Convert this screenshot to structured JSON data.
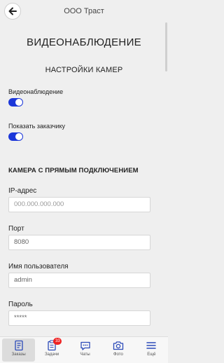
{
  "header": {
    "title": "ООО Траст"
  },
  "page": {
    "title": "ВИДЕОНАБЛЮДЕНИЕ",
    "section_title": "НАСТРОЙКИ КАМЕР"
  },
  "toggles": [
    {
      "label": "Видеонаблюдение",
      "on": true
    },
    {
      "label": "Показать заказчику",
      "on": true
    }
  ],
  "camera": {
    "heading": "КАМЕРА С ПРЯМЫМ ПОДКЛЮЧЕНИЕМ",
    "fields": [
      {
        "label": "IP-адрес",
        "value": "",
        "placeholder": "000.000.000.000"
      },
      {
        "label": "Порт",
        "value": "8080",
        "placeholder": ""
      },
      {
        "label": "Имя пользователя",
        "value": "admin",
        "placeholder": ""
      },
      {
        "label": "Пароль",
        "value": "*****",
        "placeholder": ""
      }
    ]
  },
  "bottom_nav": {
    "items": [
      {
        "label": "Заказы",
        "icon": "orders-icon",
        "active": true
      },
      {
        "label": "Задачи",
        "icon": "tasks-icon",
        "badge": "33"
      },
      {
        "label": "Чаты",
        "icon": "chat-icon"
      },
      {
        "label": "Фото",
        "icon": "camera-icon"
      },
      {
        "label": "Ещё",
        "icon": "menu-icon"
      }
    ]
  },
  "colors": {
    "accent": "#1c37d9",
    "nav_icon": "#2b4ab8",
    "badge": "#e22222"
  }
}
